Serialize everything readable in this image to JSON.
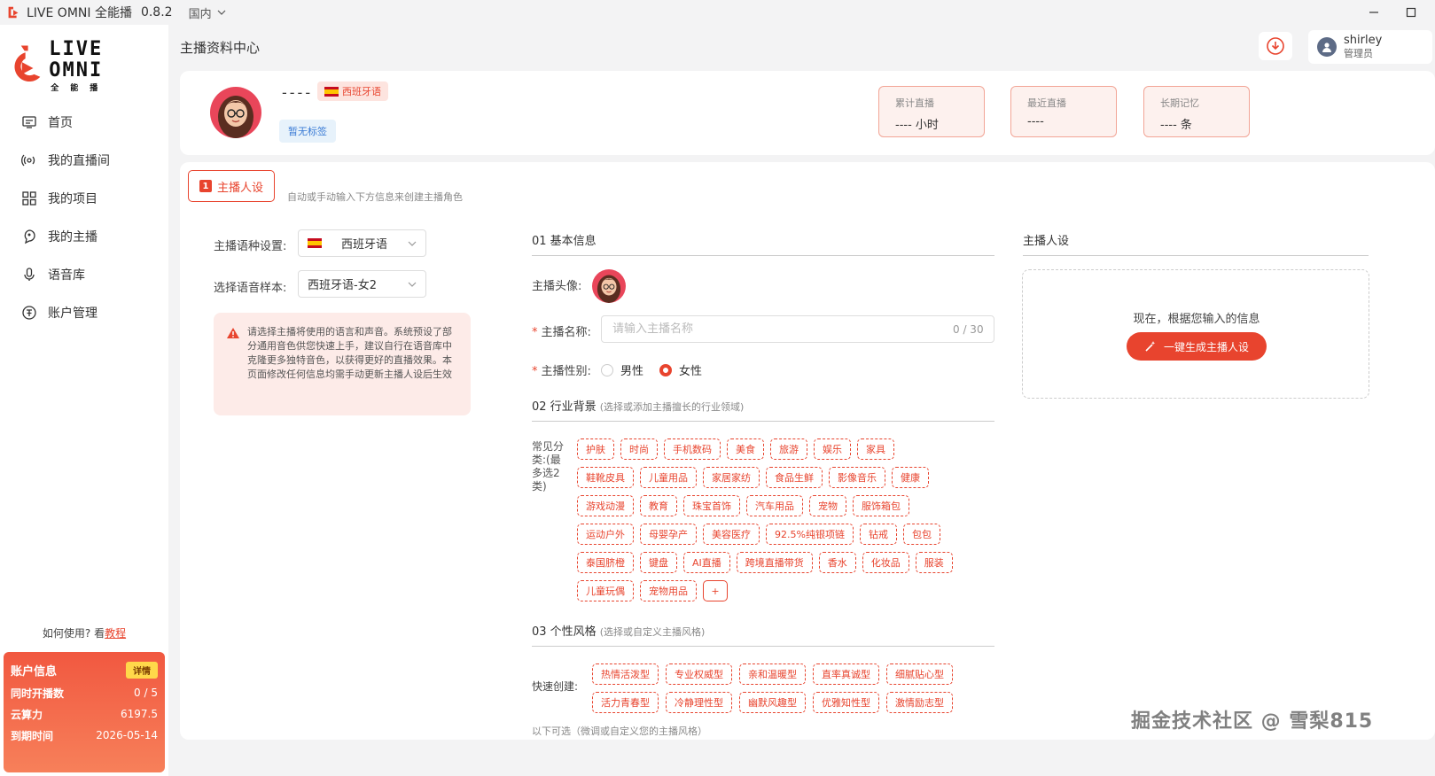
{
  "titlebar": {
    "app_title": "LIVE OMNI 全能播",
    "version": "0.8.2",
    "region": "国内"
  },
  "brand": {
    "name": "LIVE OMNI",
    "sub": "全能播"
  },
  "nav": [
    {
      "label": "首页",
      "icon": "home-icon"
    },
    {
      "label": "我的直播间",
      "icon": "broadcast-icon"
    },
    {
      "label": "我的项目",
      "icon": "grid-icon"
    },
    {
      "label": "我的主播",
      "icon": "anchor-icon"
    },
    {
      "label": "语音库",
      "icon": "microphone-icon"
    },
    {
      "label": "账户管理",
      "icon": "account-icon"
    }
  ],
  "howto": {
    "prefix": "如何使用? 看",
    "link": "教程"
  },
  "account": {
    "title": "账户信息",
    "detail_label": "详情",
    "rows": [
      {
        "label": "同时开播数",
        "value": "0 / 5"
      },
      {
        "label": "云算力",
        "value": "6197.5"
      },
      {
        "label": "到期时间",
        "value": "2026-05-14"
      }
    ]
  },
  "header": {
    "page_title": "主播资料中心",
    "user_name": "shirley",
    "user_role": "管理员"
  },
  "profile": {
    "name": "----",
    "language_chip": "西班牙语",
    "tag_chip": "暂无标签",
    "stats": [
      {
        "label": "累计直播",
        "value": "---- 小时"
      },
      {
        "label": "最近直播",
        "value": "----"
      },
      {
        "label": "长期记忆",
        "value": "---- 条"
      }
    ]
  },
  "panel": {
    "tab": {
      "num": "1",
      "label": "主播人设"
    },
    "tab_hint": "自动或手动输入下方信息来创建主播角色",
    "language_label": "主播语种设置:",
    "language_value": "西班牙语",
    "voice_label": "选择语音样本:",
    "voice_value": "西班牙语-女2",
    "warning": "请选择主播将使用的语言和声音。系统预设了部分通用音色供您快速上手，建议自行在语音库中克隆更多独特音色，以获得更好的直播效果。本页面修改任何信息均需手动更新主播人设后生效",
    "basic": {
      "title": "01 基本信息",
      "avatar_label": "主播头像:",
      "name_label": "主播名称:",
      "name_placeholder": "请输入主播名称",
      "name_count": "0 / 30",
      "gender_label": "主播性别:",
      "gender_male": "男性",
      "gender_female": "女性"
    },
    "industry": {
      "title": "02 行业背景",
      "subtitle": "(选择或添加主播擅长的行业领域)",
      "category_label": "常见分类:(最多选2类)",
      "rows": [
        [
          "护肤",
          "时尚",
          "手机数码",
          "美食",
          "旅游",
          "娱乐",
          "家具"
        ],
        [
          "鞋靴皮具",
          "儿童用品",
          "家居家纺",
          "食品生鲜",
          "影像音乐",
          "健康"
        ],
        [
          "游戏动漫",
          "教育",
          "珠宝首饰",
          "汽车用品",
          "宠物",
          "服饰箱包"
        ],
        [
          "运动户外",
          "母婴孕产",
          "美容医疗",
          "92.5%纯银项链",
          "钻戒",
          "包包"
        ],
        [
          "泰国脐橙",
          "键盘",
          "AI直播",
          "跨境直播带货",
          "香水",
          "化妆品",
          "服装"
        ],
        [
          "儿童玩偶",
          "宠物用品",
          "+"
        ]
      ]
    },
    "personality": {
      "title": "03 个性风格",
      "subtitle": "(选择或自定义主播风格)",
      "quick_label": "快速创建:",
      "rows": [
        [
          "热情活泼型",
          "专业权威型",
          "亲和温暖型",
          "直率真诚型",
          "细腻贴心型"
        ],
        [
          "活力青春型",
          "冷静理性型",
          "幽默风趣型",
          "优雅知性型",
          "激情励志型"
        ]
      ],
      "optional_hint": "以下可选（微调或自定义您的主播风格）"
    },
    "persona": {
      "title": "主播人设",
      "text": "现在，根据您输入的信息",
      "button": "一键生成主播人设"
    }
  },
  "watermark": "掘金技术社区 @ 雪梨815",
  "colors": {
    "accent": "#e8442e",
    "chip_bg": "#fde4df",
    "tag_blue": "#3a7bd5"
  }
}
